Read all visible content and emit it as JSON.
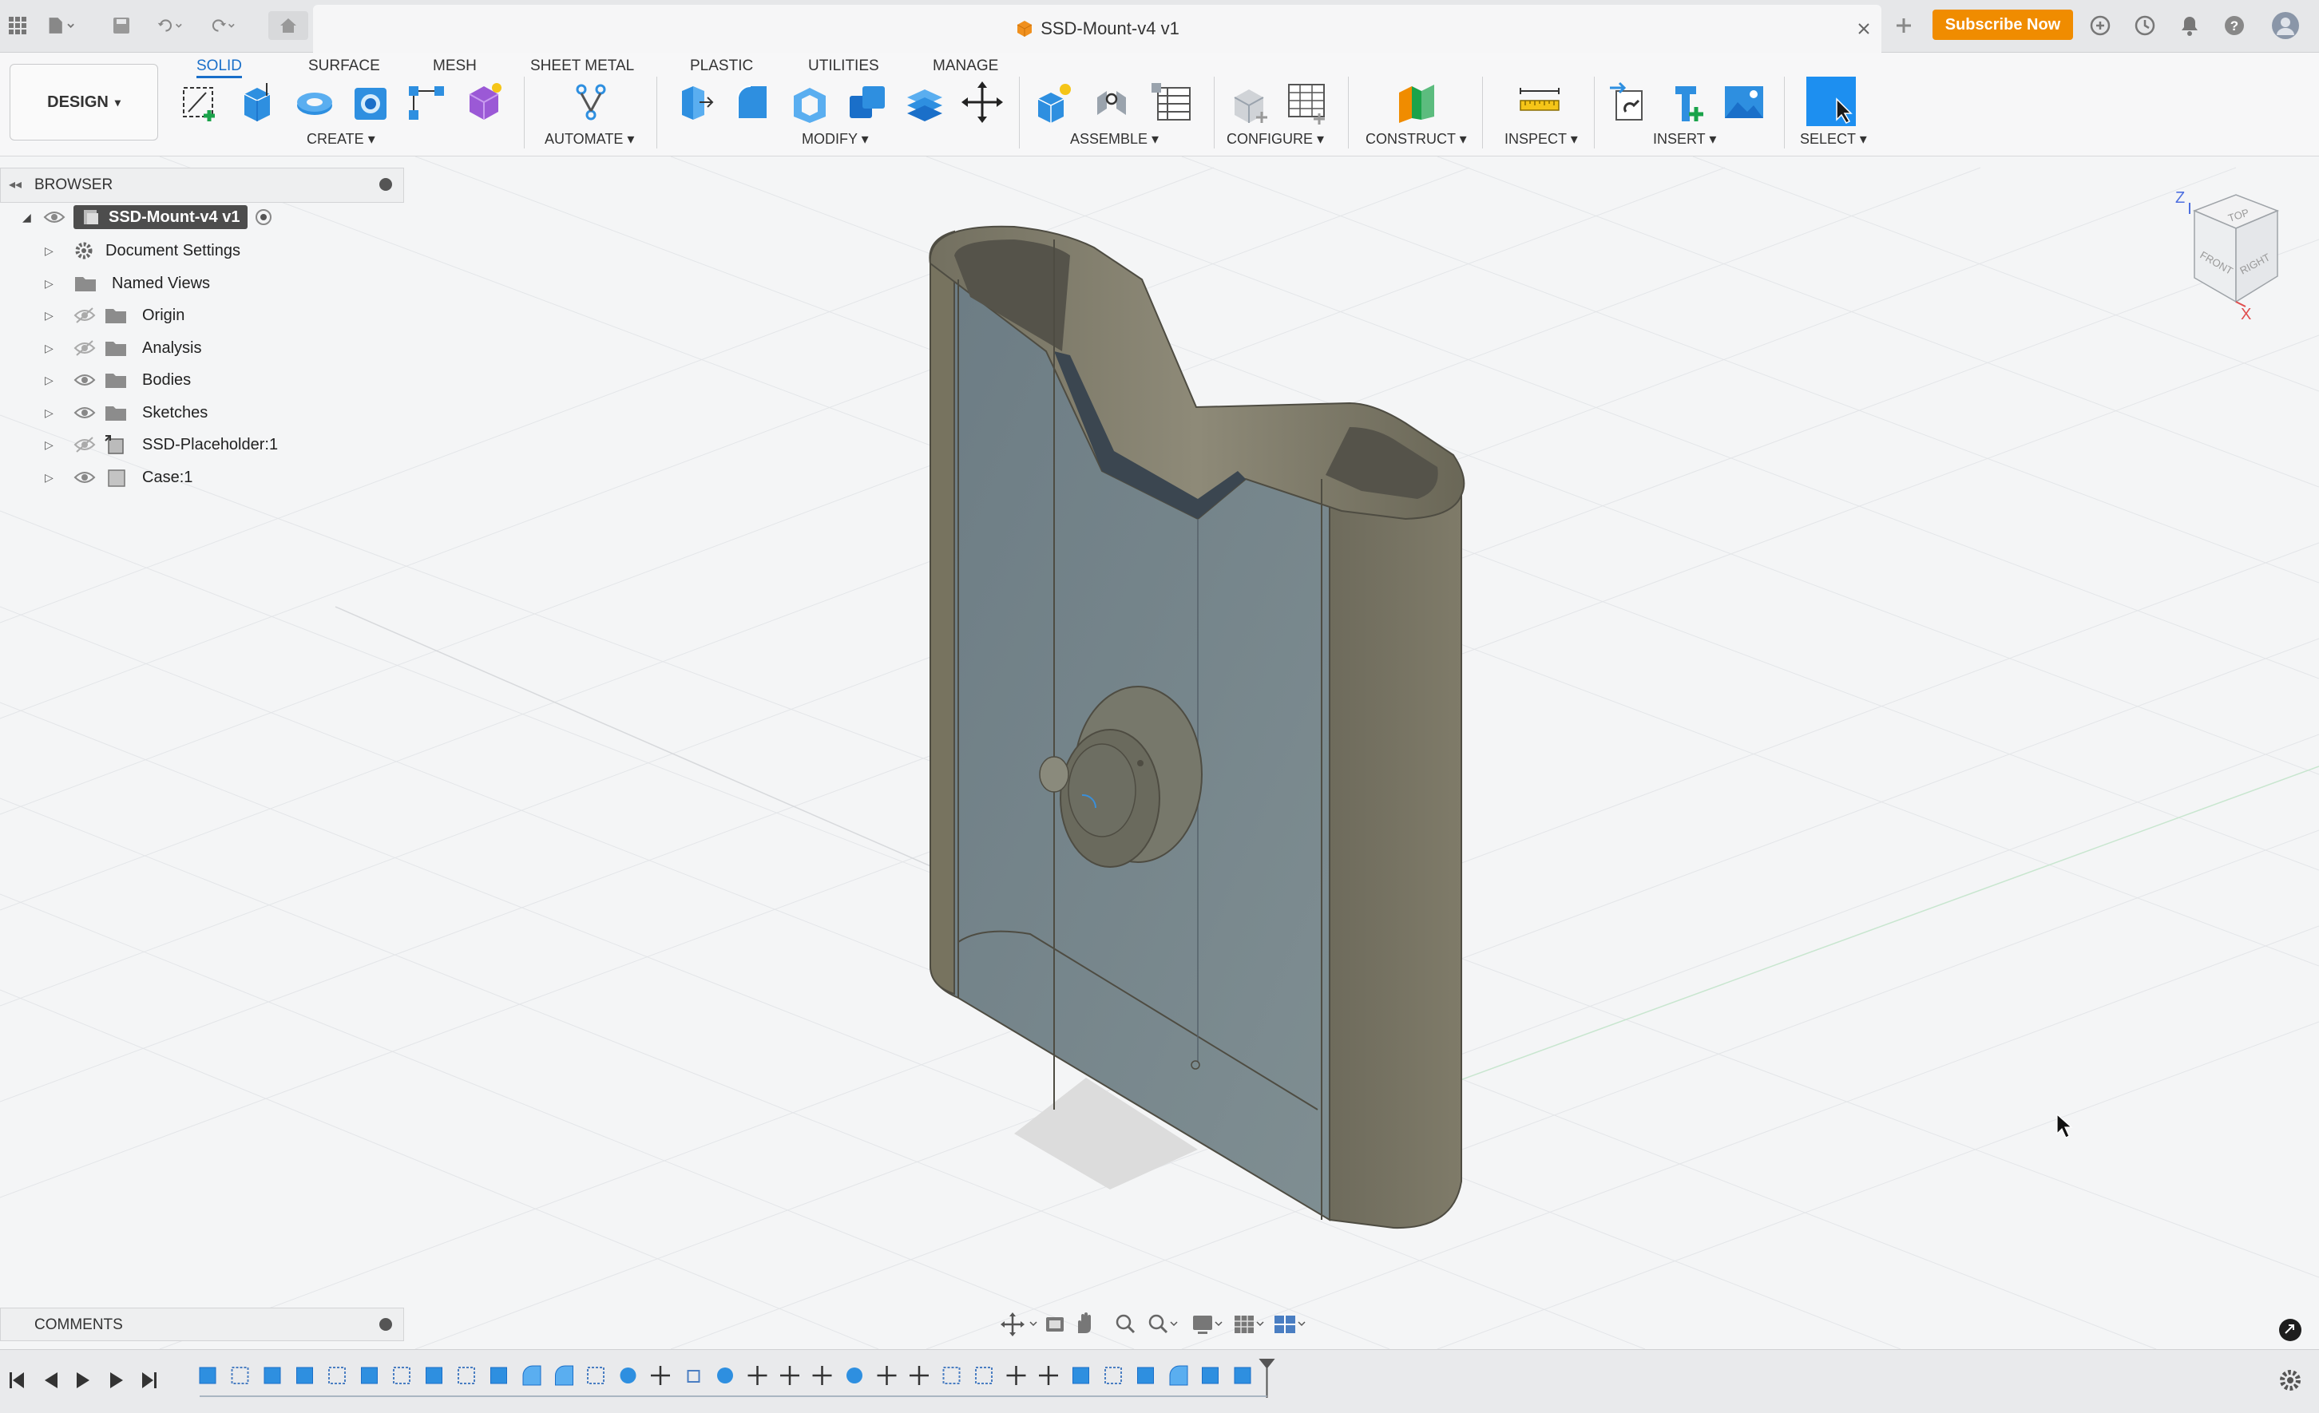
{
  "app": {
    "document_title": "SSD-Mount-v4 v1",
    "subscribe_label": "Subscribe Now",
    "accent": "#1a6fc9",
    "subscribe_color": "#f08c00"
  },
  "workspace": {
    "label": "DESIGN"
  },
  "tabs": [
    "SOLID",
    "SURFACE",
    "MESH",
    "SHEET METAL",
    "PLASTIC",
    "UTILITIES",
    "MANAGE"
  ],
  "groups": [
    "CREATE",
    "AUTOMATE",
    "MODIFY",
    "ASSEMBLE",
    "CONFIGURE",
    "CONSTRUCT",
    "INSPECT",
    "INSERT",
    "SELECT"
  ],
  "browser": {
    "label": "BROWSER",
    "root": "SSD-Mount-v4 v1",
    "items": [
      {
        "label": "Document Settings",
        "icon": "gear-icon"
      },
      {
        "label": "Named Views",
        "icon": "folder-icon"
      },
      {
        "label": "Origin",
        "icon": "folder-icon"
      },
      {
        "label": "Analysis",
        "icon": "folder-icon"
      },
      {
        "label": "Bodies",
        "icon": "folder-icon"
      },
      {
        "label": "Sketches",
        "icon": "folder-icon"
      },
      {
        "label": "SSD-Placeholder:1",
        "icon": "component-link-icon"
      },
      {
        "label": "Case:1",
        "icon": "component-icon"
      }
    ]
  },
  "viewcube": {
    "top": "TOP",
    "front": "FRONT",
    "right": "RIGHT",
    "axis_z": "Z",
    "axis_x": "X"
  },
  "comments": {
    "label": "COMMENTS"
  }
}
